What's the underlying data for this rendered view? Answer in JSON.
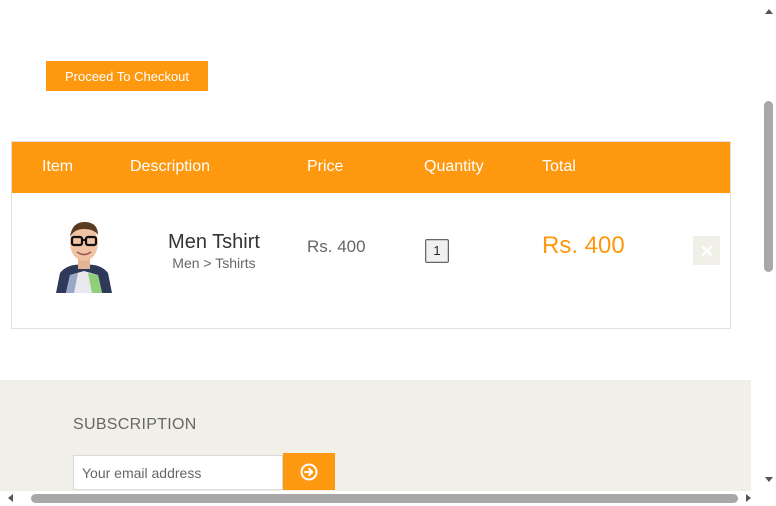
{
  "actions": {
    "checkout_label": "Proceed To Checkout"
  },
  "cart": {
    "columns": [
      "Item",
      "Description",
      "Price",
      "Quantity",
      "Total"
    ],
    "rows": [
      {
        "image": "man-in-glasses-product-photo",
        "name": "Men Tshirt",
        "category": "Men > Tshirts",
        "price": "Rs. 400",
        "quantity": "1",
        "total": "Rs. 400",
        "delete_icon": "close-icon"
      }
    ]
  },
  "subscription": {
    "title": "SUBSCRIPTION",
    "email_placeholder": "Your email address",
    "submit_icon": "arrow-circle-right-icon"
  },
  "colors": {
    "accent": "#fe980f",
    "footer_bg": "#f0f0e9",
    "text_muted": "#696763"
  }
}
